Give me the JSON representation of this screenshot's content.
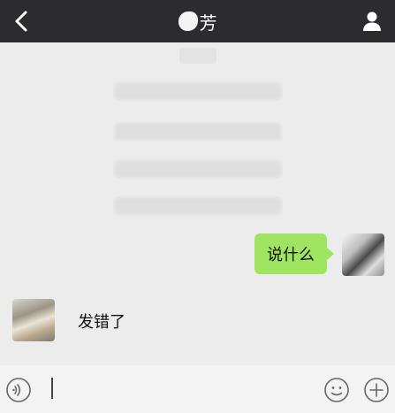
{
  "header": {
    "title": "芳"
  },
  "messages": [
    {
      "from": "me",
      "text": "说什么"
    },
    {
      "from": "other",
      "text": "发错了"
    }
  ],
  "icons": {
    "back": "back-arrow-icon",
    "profile": "person-icon",
    "voice": "voice-icon",
    "emoji": "emoji-icon",
    "plus": "plus-icon"
  },
  "colors": {
    "header_bg": "#2b2b30",
    "chat_bg": "#ececec",
    "bubble_me": "#9fe561"
  }
}
